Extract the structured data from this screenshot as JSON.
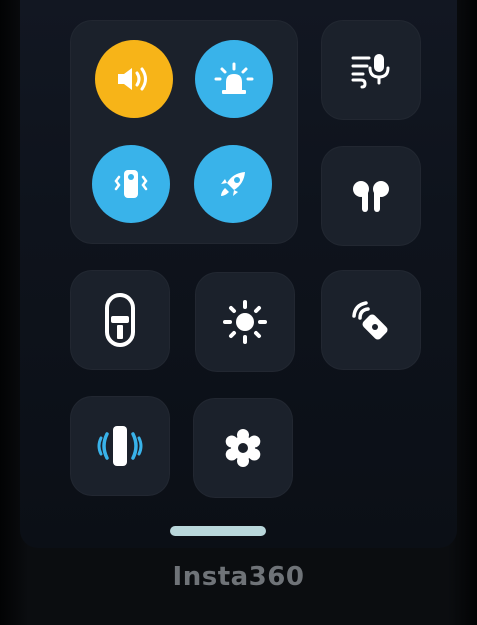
{
  "device": {
    "brand": "Insta360"
  },
  "control_center": {
    "quick_toggles": [
      {
        "name": "sound-toggle",
        "icon": "speaker-icon",
        "state": "on",
        "color": "#f7b418"
      },
      {
        "name": "indicator-light-toggle",
        "icon": "beacon-light-icon",
        "state": "on",
        "color": "#39b3ea"
      },
      {
        "name": "vibration-toggle",
        "icon": "camera-vibrate-icon",
        "state": "on",
        "color": "#39b3ea"
      },
      {
        "name": "boost-toggle",
        "icon": "rocket-icon",
        "state": "on",
        "color": "#39b3ea"
      }
    ],
    "tiles": [
      {
        "name": "wind-noise-mic-button",
        "icon": "wind-mic-icon"
      },
      {
        "name": "earbuds-button",
        "icon": "earbuds-icon"
      },
      {
        "name": "camera-mode-button",
        "icon": "camera-device-icon"
      },
      {
        "name": "brightness-button",
        "icon": "sun-icon"
      },
      {
        "name": "remote-control-button",
        "icon": "remote-signal-icon"
      },
      {
        "name": "stabilization-button",
        "icon": "stabilization-icon"
      },
      {
        "name": "settings-button",
        "icon": "gear-icon"
      }
    ]
  },
  "colors": {
    "accent_yellow": "#f7b418",
    "accent_blue": "#39b3ea",
    "tile_bg": "#1b212b",
    "icon_white": "#ffffff"
  }
}
